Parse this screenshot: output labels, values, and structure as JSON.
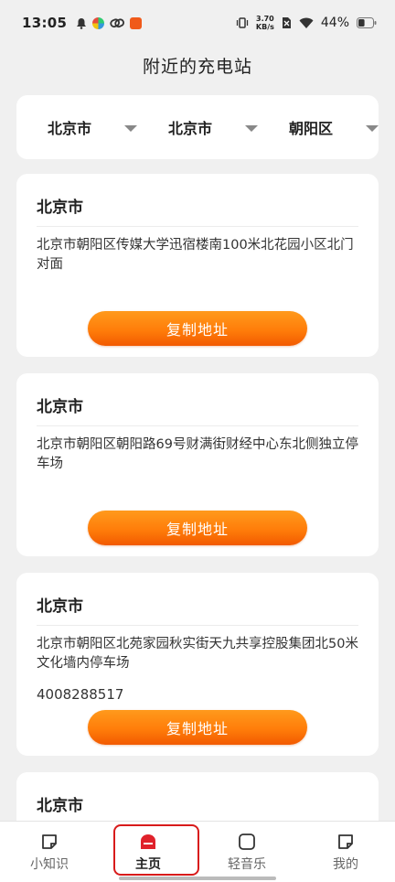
{
  "status_bar": {
    "time": "13:05",
    "net_speed_value": "3.70",
    "net_speed_unit": "KB/s",
    "battery_percent": "44%",
    "battery_level": 0.44
  },
  "page": {
    "title": "附近的充电站"
  },
  "filters": [
    {
      "label": "北京市"
    },
    {
      "label": "北京市"
    },
    {
      "label": "朝阳区"
    }
  ],
  "stations": [
    {
      "city": "北京市",
      "address": "北京市朝阳区传媒大学迅宿楼南100米北花园小区北门对面",
      "phone": "",
      "button": "复制地址"
    },
    {
      "city": "北京市",
      "address": "北京市朝阳区朝阳路69号财满街财经中心东北侧独立停车场",
      "phone": "",
      "button": "复制地址"
    },
    {
      "city": "北京市",
      "address": "北京市朝阳区北苑家园秋实街天九共享控股集团北50米文化墙内停车场",
      "phone": "4008288517",
      "button": "复制地址"
    },
    {
      "city": "北京市"
    }
  ],
  "bottom_nav": [
    {
      "label": "小知识",
      "icon": "note-icon",
      "active": false
    },
    {
      "label": "主页",
      "icon": "home-icon",
      "active": true
    },
    {
      "label": "轻音乐",
      "icon": "square-icon",
      "active": false
    },
    {
      "label": "我的",
      "icon": "note-icon",
      "active": false
    }
  ],
  "colors": {
    "accent": "#ff7d0a",
    "highlight_box": "#d81b1b",
    "home_icon": "#e0222b"
  }
}
